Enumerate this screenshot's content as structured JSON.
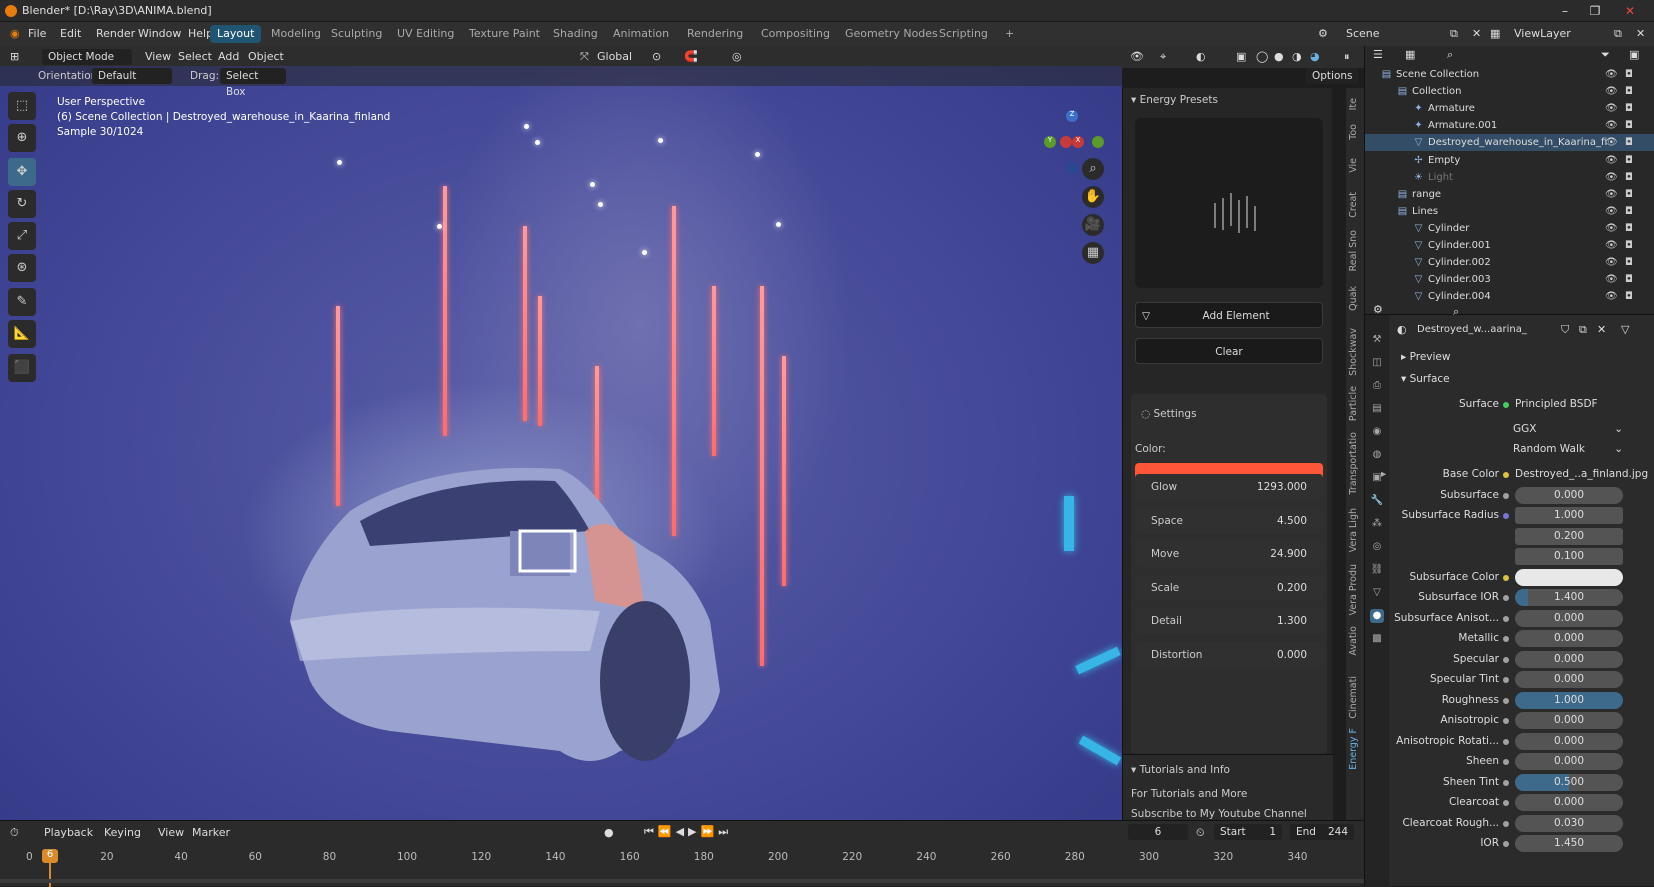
{
  "title": "Blender* [D:\\Ray\\3D\\ANIMA.blend]",
  "menus": [
    "File",
    "Edit",
    "Render",
    "Window",
    "Help"
  ],
  "workspaces": [
    "Layout",
    "Modeling",
    "Sculpting",
    "UV Editing",
    "Texture Paint",
    "Shading",
    "Animation",
    "Rendering",
    "Compositing",
    "Geometry Nodes",
    "Scripting",
    "+"
  ],
  "scene": "Scene",
  "view_layer": "ViewLayer",
  "toolbar": {
    "mode": "Object Mode",
    "view": "View",
    "select": "Select",
    "add": "Add",
    "object": "Object",
    "transform": "Global"
  },
  "header": {
    "orientation_label": "Orientation:",
    "orientation": "Default",
    "drag_label": "Drag:",
    "drag": "Select Box",
    "options": "Options"
  },
  "overlay": {
    "line1": "User Perspective",
    "line2": "(6) Scene Collection | Destroyed_warehouse_in_Kaarina_finland",
    "line3": "Sample 30/1024"
  },
  "energy": {
    "presets_title": "Energy Presets",
    "add_element": "Add Element",
    "clear": "Clear",
    "settings_title": "Settings",
    "color_label": "Color:",
    "color": "#ff5538",
    "fields": [
      {
        "label": "Glow",
        "value": "1293.000"
      },
      {
        "label": "Space",
        "value": "4.500"
      },
      {
        "label": "Move",
        "value": "24.900"
      },
      {
        "label": "Scale",
        "value": "0.200"
      },
      {
        "label": "Detail",
        "value": "1.300"
      },
      {
        "label": "Distortion",
        "value": "0.000"
      }
    ],
    "tutorials_title": "Tutorials and Info",
    "tut1": "For Tutorials and More",
    "tut2": "Subscribe to My Youtube Channel"
  },
  "side_tabs": [
    "Ite",
    "Too",
    "Vie",
    "Creat",
    "Real Sno",
    "Quak",
    "Shockwav",
    "Particle",
    "Transportatio",
    "Vera Ligh",
    "Vera Produ",
    "Avatio",
    "Cinemati",
    "Energy F"
  ],
  "timeline": {
    "playback": "Playback",
    "keying": "Keying",
    "view": "View",
    "marker": "Marker",
    "current": "6",
    "start_label": "Start",
    "start": "1",
    "end_label": "End",
    "end": "244",
    "ticks": [
      "0",
      "20",
      "40",
      "60",
      "80",
      "100",
      "120",
      "140",
      "160",
      "180",
      "200",
      "220",
      "240",
      "260",
      "280",
      "300",
      "320",
      "340"
    ],
    "frame_badge": "6"
  },
  "outliner": {
    "rows": [
      {
        "label": "Scene Collection",
        "indent": 0,
        "icon": "▤"
      },
      {
        "label": "Collection",
        "indent": 1,
        "icon": "▤"
      },
      {
        "label": "Armature",
        "indent": 2,
        "icon": "✦"
      },
      {
        "label": "Armature.001",
        "indent": 2,
        "icon": "✦"
      },
      {
        "label": "Destroyed_warehouse_in_Kaarina_fi",
        "indent": 2,
        "icon": "▽",
        "sel": true
      },
      {
        "label": "Empty",
        "indent": 2,
        "icon": "✢"
      },
      {
        "label": "Light",
        "indent": 2,
        "icon": "☀"
      },
      {
        "label": "range",
        "indent": 1,
        "icon": "▤"
      },
      {
        "label": "Lines",
        "indent": 1,
        "icon": "▤"
      },
      {
        "label": "Cylinder",
        "indent": 2,
        "icon": "▽"
      },
      {
        "label": "Cylinder.001",
        "indent": 2,
        "icon": "▽"
      },
      {
        "label": "Cylinder.002",
        "indent": 2,
        "icon": "▽"
      },
      {
        "label": "Cylinder.003",
        "indent": 2,
        "icon": "▽"
      },
      {
        "label": "Cylinder.004",
        "indent": 2,
        "icon": "▽"
      }
    ]
  },
  "props": {
    "material": "Destroyed_w...aarina_finland",
    "preview": "Preview",
    "surface_section": "Surface",
    "surface_label": "Surface",
    "surface_value": "Principled BSDF",
    "dist": "GGX",
    "sss_method": "Random Walk",
    "rows": [
      {
        "label": "Base Color",
        "text": "Destroyed_..a_finland.jpg"
      },
      {
        "label": "Subsurface",
        "value": "0.000"
      },
      {
        "label": "Subsurface Radius",
        "value": "1.000"
      },
      {
        "label": "",
        "value": "0.200"
      },
      {
        "label": "",
        "value": "0.100"
      },
      {
        "label": "Subsurface Color",
        "value": ""
      },
      {
        "label": "Subsurface IOR",
        "value": "1.400"
      },
      {
        "label": "Subsurface Anisot...",
        "value": "0.000"
      },
      {
        "label": "Metallic",
        "value": "0.000"
      },
      {
        "label": "Specular",
        "value": "0.000"
      },
      {
        "label": "Specular Tint",
        "value": "0.000"
      },
      {
        "label": "Roughness",
        "value": "1.000"
      },
      {
        "label": "Anisotropic",
        "value": "0.000"
      },
      {
        "label": "Anisotropic Rotati...",
        "value": "0.000"
      },
      {
        "label": "Sheen",
        "value": "0.000"
      },
      {
        "label": "Sheen Tint",
        "value": "0.500"
      },
      {
        "label": "Clearcoat",
        "value": "0.000"
      },
      {
        "label": "Clearcoat Rough...",
        "value": "0.030"
      },
      {
        "label": "IOR",
        "value": "1.450"
      }
    ]
  }
}
